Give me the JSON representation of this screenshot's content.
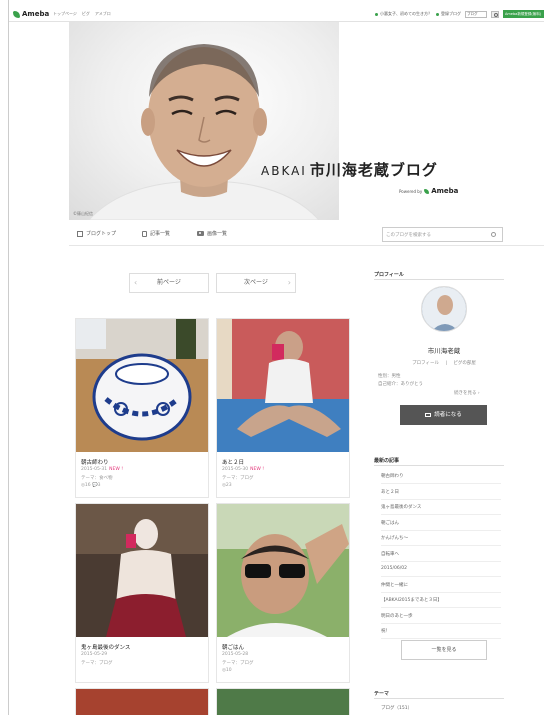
{
  "topbar": {
    "logo": "Ameba",
    "links": [
      "トップページ",
      "ピグ",
      "アメブロ"
    ],
    "notice": "小悪女子、初めての生き方？",
    "register": "登録ブログ",
    "search_select": "ブログ",
    "start": "Ameba新規登録(無料)"
  },
  "header": {
    "title_prefix": "ABKAI",
    "title_main": "市川海老蔵ブログ",
    "powered": "Powered by",
    "brand": "Ameba",
    "photo_caption": "©篠山紀信"
  },
  "nav": {
    "top": "ブログトップ",
    "articles": "記事一覧",
    "images": "画像一覧",
    "search_placeholder": "このブログを検索する"
  },
  "pager": {
    "prev": "前ページ",
    "next": "次ページ"
  },
  "posts": [
    {
      "title": "朝古師わり",
      "date": "2015-05-31",
      "new": "NEW !",
      "theme": "テーマ：食べ物",
      "stats": "◎16  💬3"
    },
    {
      "title": "あと２日",
      "date": "2015-05-30",
      "new": "NEW !",
      "theme": "テーマ：ブログ",
      "stats": "◎23"
    },
    {
      "title": "鬼ヶ島最後のダンス",
      "date": "2015-05-29",
      "new": "",
      "theme": "テーマ：ブログ",
      "stats": ""
    },
    {
      "title": "朝ごはん",
      "date": "2015-05-28",
      "new": "",
      "theme": "テーマ：ブログ",
      "stats": "◎10"
    }
  ],
  "sidebar": {
    "profile_heading": "プロフィール",
    "name": "市川海老蔵",
    "profile_link": "プロフィール",
    "separator": "|",
    "pigg_link": "ピグの部屋",
    "info1": "性別：男性",
    "info2": "自己紹介：ありがとう",
    "more": "続きを見る ›",
    "reader_button": "読者になる",
    "recent_heading": "最新の記事",
    "recent": [
      "朝古師わり",
      "あと２日",
      "鬼ヶ島最後のダンス",
      "朝ごはん",
      "かんげんち〜",
      "自転車へ",
      "2015/06/02",
      "仲間と一緒に",
      "【ABKAI2015まであと３日】",
      "明日のあと一歩",
      "祝！"
    ],
    "list_button": "一覧を見る",
    "theme_heading": "テーマ",
    "theme_item": "ブログ（151）"
  },
  "colors": {
    "accent": "#3aa14b",
    "new": "#e4387b",
    "button": "#555555"
  }
}
